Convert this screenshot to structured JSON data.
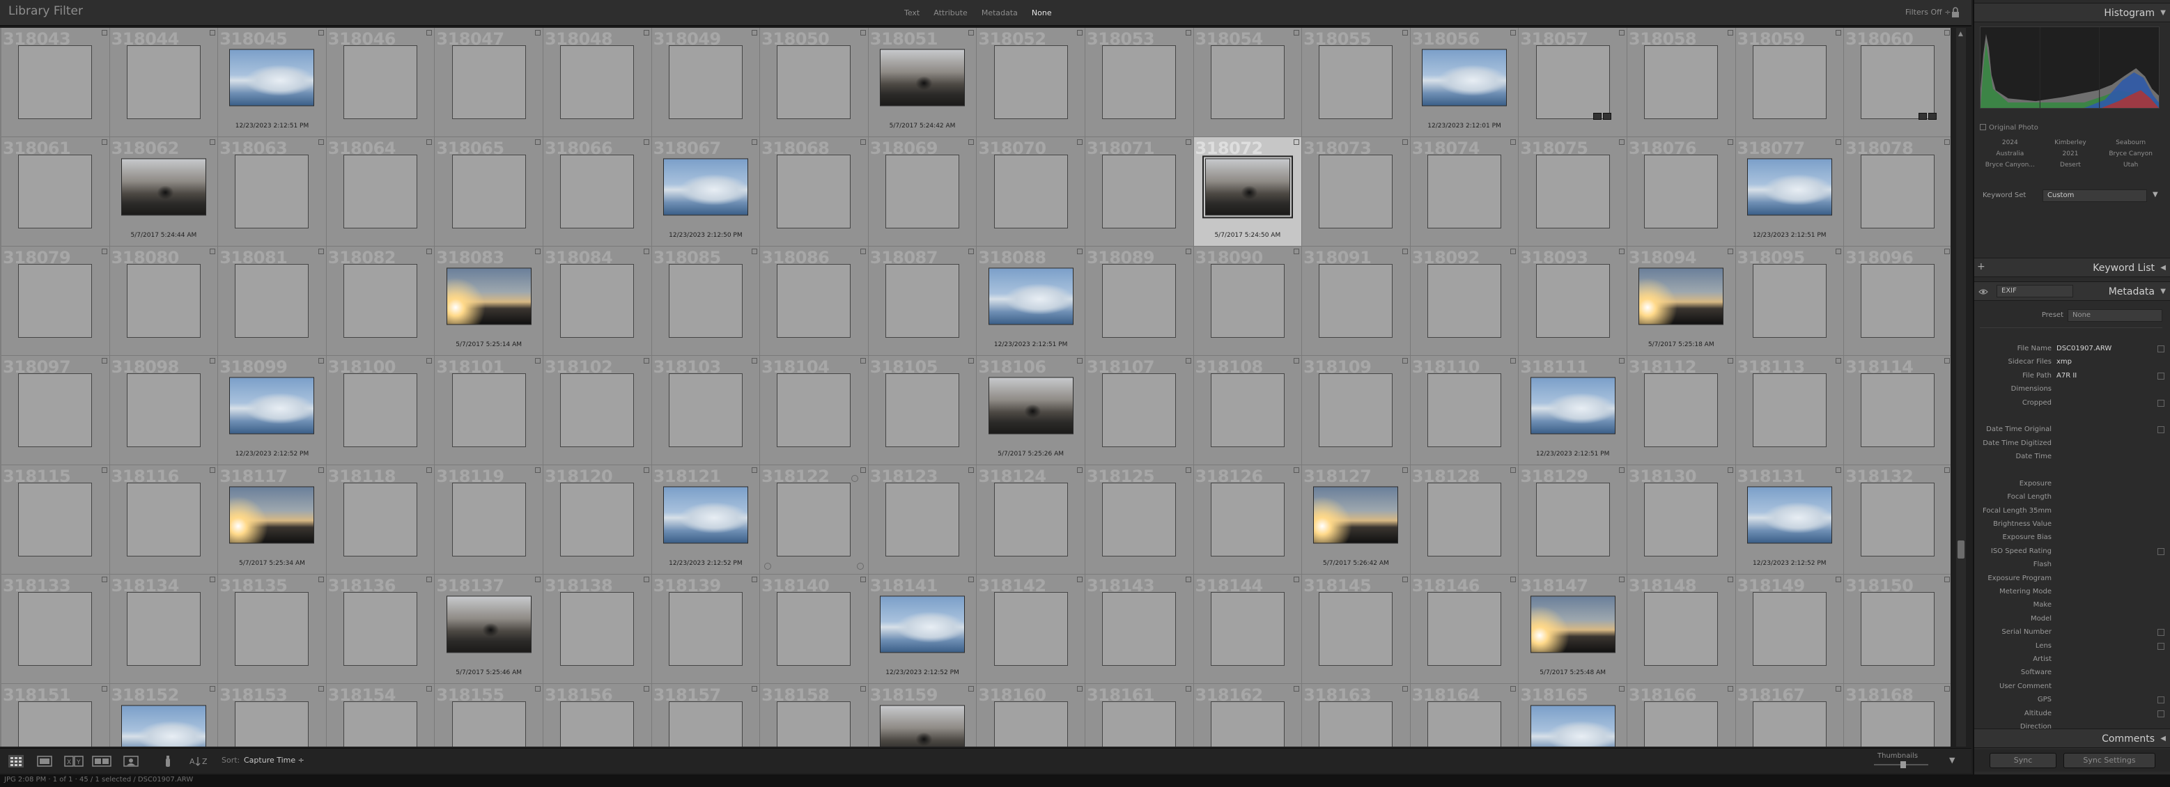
{
  "filter_bar": {
    "title": "Library Filter",
    "tabs": [
      "Text",
      "Attribute",
      "Metadata",
      "None"
    ],
    "active_tab": "None",
    "filters_status": "Filters Off ÷"
  },
  "grid": {
    "columns": 18,
    "selected_index": 29,
    "cells": [
      {
        "n": "318043"
      },
      {
        "n": "318044"
      },
      {
        "n": "318045",
        "img": "ice",
        "cap": "12/23/2023 2:12:51 PM"
      },
      {
        "n": "318046"
      },
      {
        "n": "318047"
      },
      {
        "n": "318048"
      },
      {
        "n": "318049"
      },
      {
        "n": "318050"
      },
      {
        "n": "318051",
        "img": "mtn",
        "cap": "5/7/2017 5:24:42 AM"
      },
      {
        "n": "318052"
      },
      {
        "n": "318053"
      },
      {
        "n": "318054"
      },
      {
        "n": "318055"
      },
      {
        "n": "318056",
        "img": "ice",
        "cap": "12/23/2023 2:12:01 PM"
      },
      {
        "n": "318057",
        "badges": true
      },
      {
        "n": "318058"
      },
      {
        "n": "318059"
      },
      {
        "n": "318060",
        "badges": true
      },
      {
        "n": "318061"
      },
      {
        "n": "318062",
        "img": "mtn",
        "cap": "5/7/2017 5:24:44 AM"
      },
      {
        "n": "318063"
      },
      {
        "n": "318064"
      },
      {
        "n": "318065"
      },
      {
        "n": "318066"
      },
      {
        "n": "318067",
        "img": "ice",
        "cap": "12/23/2023 2:12:50 PM"
      },
      {
        "n": "318068"
      },
      {
        "n": "318069"
      },
      {
        "n": "318070"
      },
      {
        "n": "318071"
      },
      {
        "n": "318072",
        "img": "mtn",
        "cap": "5/7/2017 5:24:50 AM"
      },
      {
        "n": "318073"
      },
      {
        "n": "318074"
      },
      {
        "n": "318075"
      },
      {
        "n": "318076"
      },
      {
        "n": "318077",
        "img": "ice",
        "cap": "12/23/2023 2:12:51 PM"
      },
      {
        "n": "318078"
      },
      {
        "n": "318079"
      },
      {
        "n": "318080"
      },
      {
        "n": "318081"
      },
      {
        "n": "318082"
      },
      {
        "n": "318083",
        "img": "sunset",
        "cap": "5/7/2017 5:25:14 AM"
      },
      {
        "n": "318084"
      },
      {
        "n": "318085"
      },
      {
        "n": "318086"
      },
      {
        "n": "318087"
      },
      {
        "n": "318088",
        "img": "ice",
        "cap": "12/23/2023 2:12:51 PM"
      },
      {
        "n": "318089"
      },
      {
        "n": "318090"
      },
      {
        "n": "318091"
      },
      {
        "n": "318092"
      },
      {
        "n": "318093"
      },
      {
        "n": "318094",
        "img": "sunset",
        "cap": "5/7/2017 5:25:18 AM"
      },
      {
        "n": "318095"
      },
      {
        "n": "318096"
      },
      {
        "n": "318097"
      },
      {
        "n": "318098"
      },
      {
        "n": "318099",
        "img": "ice",
        "cap": "12/23/2023 2:12:52 PM"
      },
      {
        "n": "318100"
      },
      {
        "n": "318101"
      },
      {
        "n": "318102"
      },
      {
        "n": "318103"
      },
      {
        "n": "318104"
      },
      {
        "n": "318105"
      },
      {
        "n": "318106",
        "img": "mtn",
        "cap": "5/7/2017 5:25:26 AM"
      },
      {
        "n": "318107"
      },
      {
        "n": "318108"
      },
      {
        "n": "318109"
      },
      {
        "n": "318110"
      },
      {
        "n": "318111",
        "img": "ice",
        "cap": "12/23/2023 2:12:51 PM"
      },
      {
        "n": "318112"
      },
      {
        "n": "318113"
      },
      {
        "n": "318114"
      },
      {
        "n": "318115"
      },
      {
        "n": "318116"
      },
      {
        "n": "318117",
        "img": "sunset",
        "cap": "5/7/2017 5:25:34 AM"
      },
      {
        "n": "318118"
      },
      {
        "n": "318119"
      },
      {
        "n": "318120"
      },
      {
        "n": "318121",
        "img": "ice",
        "cap": "12/23/2023 2:12:52 PM"
      },
      {
        "n": "318122",
        "rot": true
      },
      {
        "n": "318123"
      },
      {
        "n": "318124"
      },
      {
        "n": "318125"
      },
      {
        "n": "318126"
      },
      {
        "n": "318127",
        "img": "sunset",
        "cap": "5/7/2017 5:26:42 AM"
      },
      {
        "n": "318128"
      },
      {
        "n": "318129"
      },
      {
        "n": "318130"
      },
      {
        "n": "318131",
        "img": "ice",
        "cap": "12/23/2023 2:12:52 PM"
      },
      {
        "n": "318132"
      },
      {
        "n": "318133"
      },
      {
        "n": "318134"
      },
      {
        "n": "318135"
      },
      {
        "n": "318136"
      },
      {
        "n": "318137",
        "img": "mtn",
        "cap": "5/7/2017 5:25:46 AM"
      },
      {
        "n": "318138"
      },
      {
        "n": "318139"
      },
      {
        "n": "318140"
      },
      {
        "n": "318141",
        "img": "ice",
        "cap": "12/23/2023 2:12:52 PM"
      },
      {
        "n": "318142"
      },
      {
        "n": "318143"
      },
      {
        "n": "318144"
      },
      {
        "n": "318145"
      },
      {
        "n": "318146"
      },
      {
        "n": "318147",
        "img": "sunset",
        "cap": "5/7/2017 5:25:48 AM"
      },
      {
        "n": "318148"
      },
      {
        "n": "318149"
      },
      {
        "n": "318150"
      },
      {
        "n": "318151"
      },
      {
        "n": "318152",
        "img": "ice",
        "cap": ""
      },
      {
        "n": "318153"
      },
      {
        "n": "318154"
      },
      {
        "n": "318155"
      },
      {
        "n": "318156"
      },
      {
        "n": "318157"
      },
      {
        "n": "318158"
      },
      {
        "n": "318159",
        "img": "mtn",
        "cap": ""
      },
      {
        "n": "318160"
      },
      {
        "n": "318161"
      },
      {
        "n": "318162"
      },
      {
        "n": "318163"
      },
      {
        "n": "318164"
      },
      {
        "n": "318165",
        "img": "ice",
        "cap": ""
      },
      {
        "n": "318166"
      },
      {
        "n": "318167"
      },
      {
        "n": "318168"
      }
    ]
  },
  "toolbar": {
    "sort_label": "Sort:",
    "sort_value": "Capture Time ÷",
    "thumbnails_label": "Thumbnails",
    "dropdown_glyph": "▼"
  },
  "status_bar": {
    "text": "JPG 2:08 PM · 1 of 1 · 45 / 1 selected / DSC01907.ARW"
  },
  "right_panel": {
    "histogram": {
      "title": "Histogram",
      "original_photo": "Original Photo"
    },
    "keywords": [
      "2024",
      "Kimberley",
      "Seabourn",
      "Australia",
      "2021",
      "Bryce Canyon",
      "Bryce Canyon...",
      "Desert",
      "Utah"
    ],
    "keyword_set": {
      "label": "Keyword Set",
      "value": "Custom"
    },
    "keyword_list": {
      "title": "Keyword List",
      "plus": "+"
    },
    "metadata": {
      "title": "Metadata",
      "view": "EXIF",
      "preset_label": "Preset",
      "preset_value": "None",
      "fields": [
        {
          "label": "File Name",
          "value": "DSC01907.ARW",
          "btn": true
        },
        {
          "label": "Sidecar Files",
          "value": "xmp"
        },
        {
          "label": "File Path",
          "value": "A7R II",
          "btn": true
        },
        {
          "label": "Dimensions",
          "value": ""
        },
        {
          "label": "Cropped",
          "value": "",
          "btn": true
        },
        {
          "label": "",
          "value": ""
        },
        {
          "label": "Date Time Original",
          "value": "",
          "btn": true
        },
        {
          "label": "Date Time Digitized",
          "value": ""
        },
        {
          "label": "Date Time",
          "value": ""
        },
        {
          "label": "",
          "value": ""
        },
        {
          "label": "Exposure",
          "value": ""
        },
        {
          "label": "Focal Length",
          "value": ""
        },
        {
          "label": "Focal Length 35mm",
          "value": ""
        },
        {
          "label": "Brightness Value",
          "value": ""
        },
        {
          "label": "Exposure Bias",
          "value": ""
        },
        {
          "label": "ISO Speed Rating",
          "value": "",
          "btn": true
        },
        {
          "label": "Flash",
          "value": ""
        },
        {
          "label": "Exposure Program",
          "value": ""
        },
        {
          "label": "Metering Mode",
          "value": ""
        },
        {
          "label": "Make",
          "value": ""
        },
        {
          "label": "Model",
          "value": ""
        },
        {
          "label": "Serial Number",
          "value": "",
          "btn": true
        },
        {
          "label": "Lens",
          "value": "",
          "btn": true
        },
        {
          "label": "Artist",
          "value": ""
        },
        {
          "label": "Software",
          "value": ""
        },
        {
          "label": "User Comment",
          "value": ""
        },
        {
          "label": "GPS",
          "value": "",
          "btn": true
        },
        {
          "label": "Altitude",
          "value": "",
          "btn": true
        },
        {
          "label": "Direction",
          "value": ""
        }
      ]
    },
    "comments": {
      "title": "Comments"
    },
    "buttons": {
      "sync": "Sync",
      "sync_settings": "Sync Settings"
    }
  },
  "colors": {
    "accent": "#c6c6c6",
    "panel_bg": "#2b2b2b",
    "grid_bg": "#929292"
  }
}
